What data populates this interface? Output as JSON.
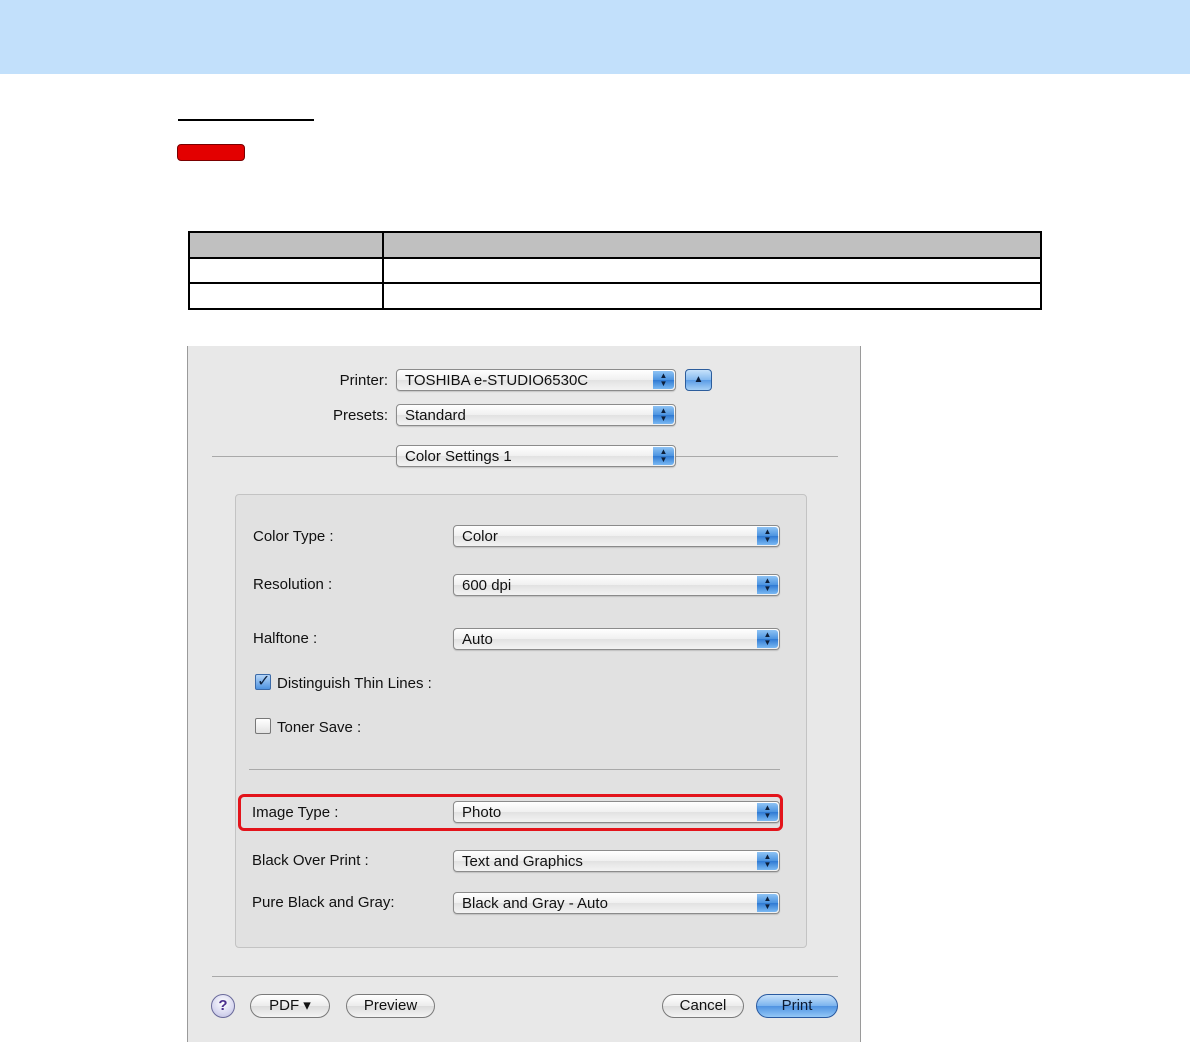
{
  "dialog": {
    "printer": {
      "label": "Printer:",
      "value": "TOSHIBA e-STUDIO6530C"
    },
    "presets": {
      "label": "Presets:",
      "value": "Standard"
    },
    "panel": {
      "value": "Color Settings 1"
    },
    "color_type": {
      "label": "Color Type :",
      "value": "Color"
    },
    "resolution": {
      "label": "Resolution :",
      "value": "600 dpi"
    },
    "halftone": {
      "label": "Halftone :",
      "value": "Auto"
    },
    "distinguish_thin_lines": {
      "label": "Distinguish Thin Lines :",
      "checked": true
    },
    "toner_save": {
      "label": "Toner Save :",
      "checked": false
    },
    "image_type": {
      "label": "Image Type :",
      "value": "Photo"
    },
    "black_over_print": {
      "label": "Black Over Print :",
      "value": "Text and Graphics"
    },
    "pure_black_gray": {
      "label": "Pure Black and Gray:",
      "value": "Black and Gray - Auto"
    },
    "buttons": {
      "help": "?",
      "pdf": "PDF ▾",
      "preview": "Preview",
      "cancel": "Cancel",
      "print": "Print"
    }
  },
  "icons": {
    "popup_arrows": "updown-arrows-icon",
    "disclosure": "disclosure-triangle-icon",
    "check": "checkmark-icon"
  },
  "colors": {
    "top_band": "#c2e0fb",
    "badge": "#e30000",
    "highlight": "#e3141b",
    "accent_blue": "#4f93e2"
  }
}
